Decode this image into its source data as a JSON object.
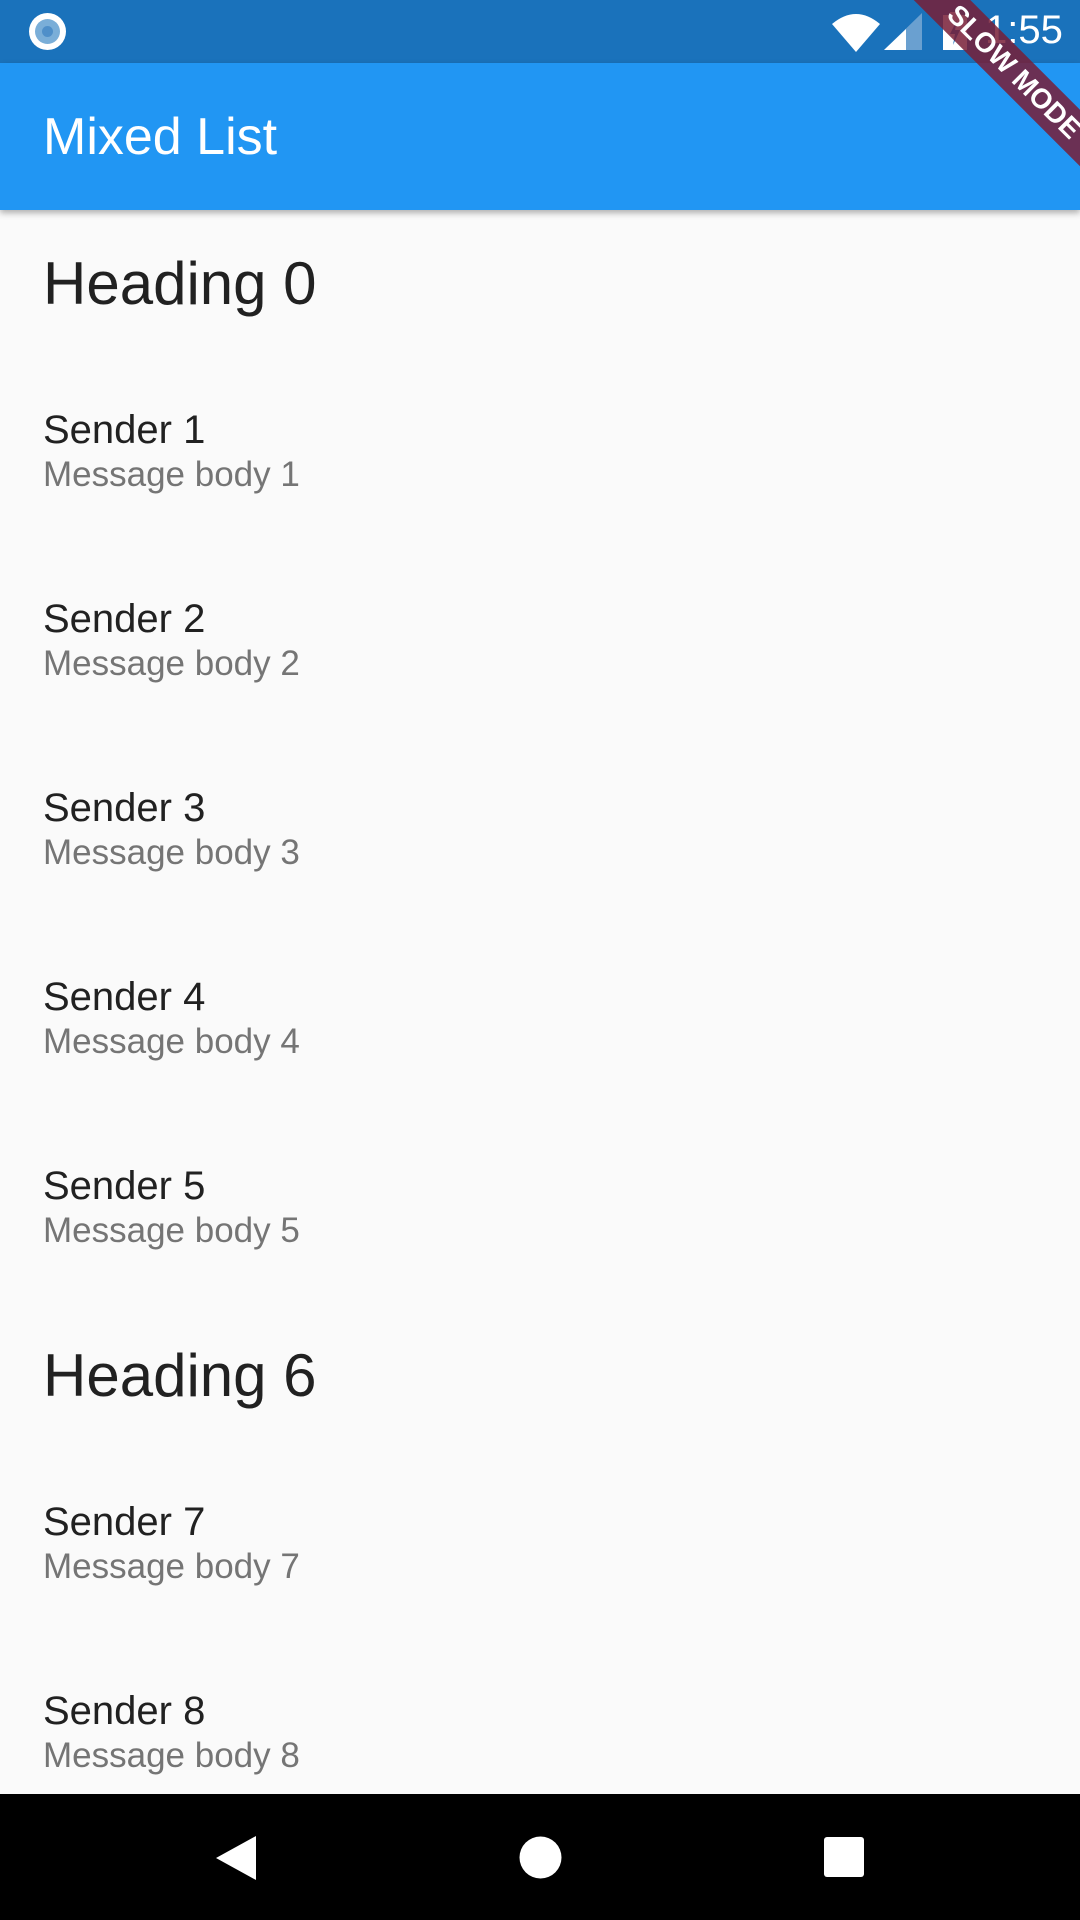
{
  "status_bar": {
    "time": "1:55",
    "icons": [
      "notification-dot-icon",
      "wifi-icon",
      "cell-signal-icon",
      "battery-charging-icon"
    ]
  },
  "app_bar": {
    "title": "Mixed List"
  },
  "debug_banner": {
    "label": "SLOW MODE"
  },
  "list": {
    "items": [
      {
        "type": "heading",
        "text": "Heading 0"
      },
      {
        "type": "message",
        "sender": "Sender 1",
        "body": "Message body 1"
      },
      {
        "type": "message",
        "sender": "Sender 2",
        "body": "Message body 2"
      },
      {
        "type": "message",
        "sender": "Sender 3",
        "body": "Message body 3"
      },
      {
        "type": "message",
        "sender": "Sender 4",
        "body": "Message body 4"
      },
      {
        "type": "message",
        "sender": "Sender 5",
        "body": "Message body 5"
      },
      {
        "type": "heading",
        "text": "Heading 6"
      },
      {
        "type": "message",
        "sender": "Sender 7",
        "body": "Message body 7"
      },
      {
        "type": "message",
        "sender": "Sender 8",
        "body": "Message body 8"
      }
    ]
  },
  "nav_bar": {
    "icons": [
      "back-icon",
      "home-icon",
      "recents-icon"
    ]
  },
  "colors": {
    "status_bar": "#1a72bb",
    "app_bar": "#2196f3",
    "background": "#fafafa",
    "banner": "#7a1e37"
  }
}
